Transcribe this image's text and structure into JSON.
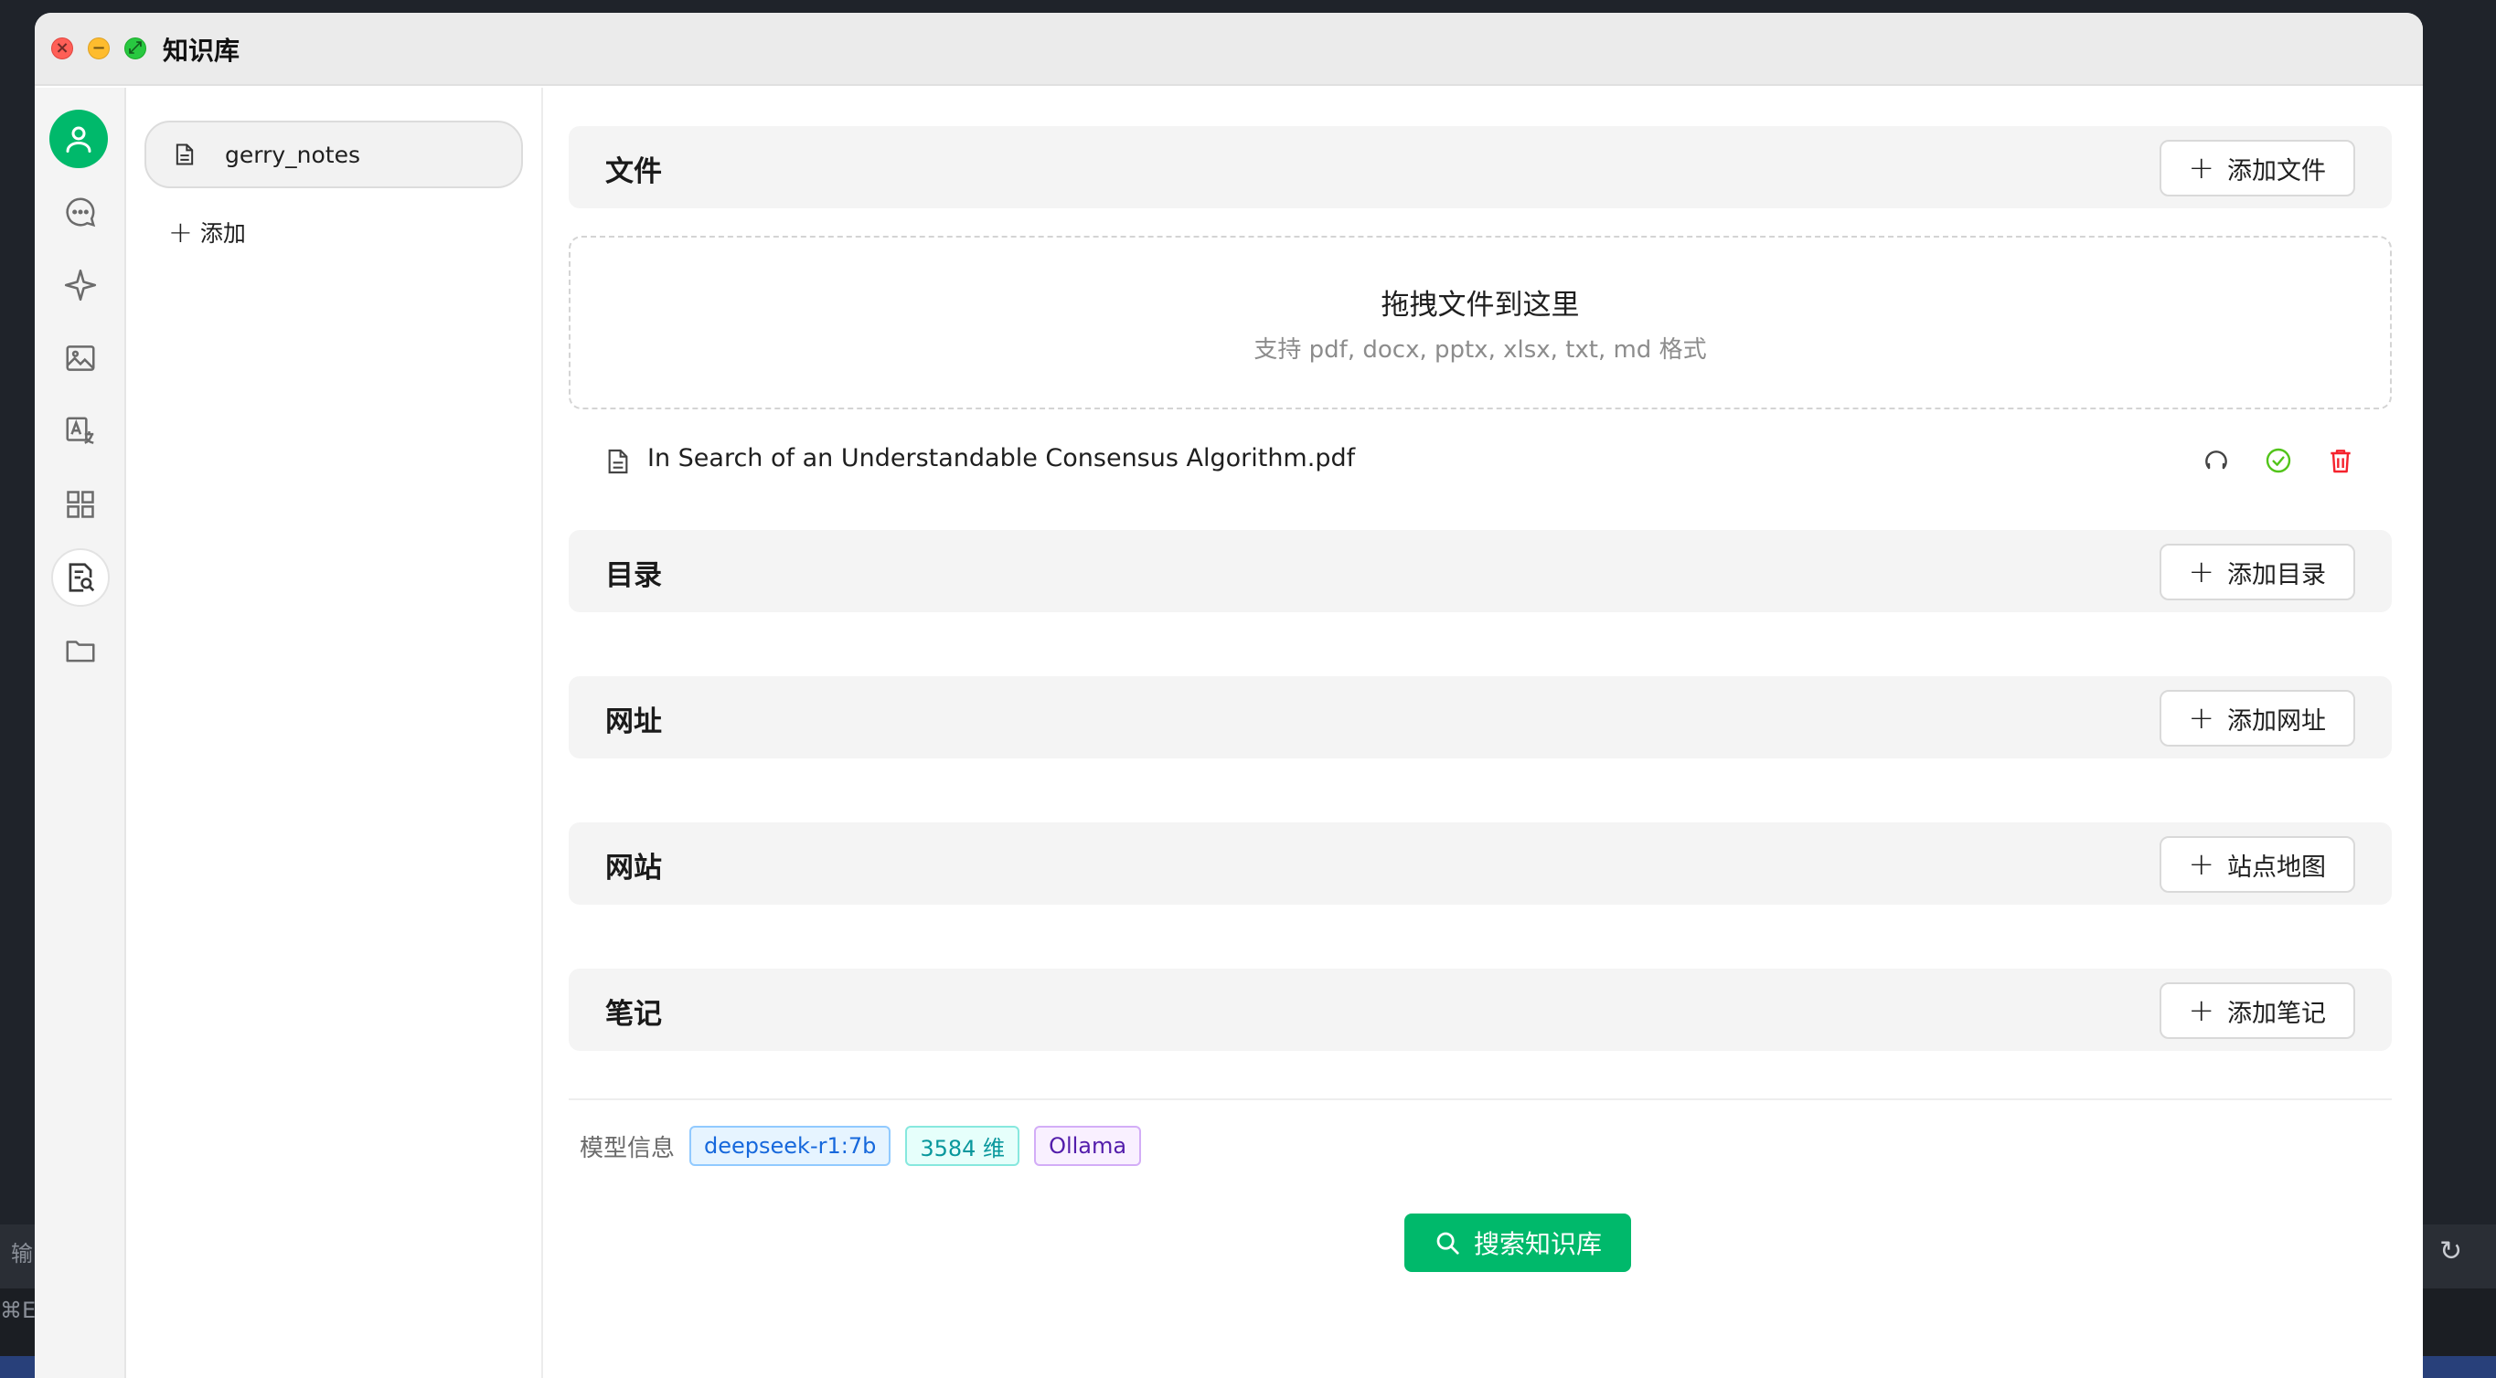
{
  "window": {
    "title": "知识库"
  },
  "background": {
    "left_text_1": "输",
    "left_text_2": "⌘E"
  },
  "knowledge_bases": {
    "items": [
      {
        "label": "gerry_notes"
      }
    ],
    "add_label": "添加"
  },
  "sections": {
    "files": {
      "title": "文件",
      "button": "添加文件"
    },
    "directories": {
      "title": "目录",
      "button": "添加目录"
    },
    "urls": {
      "title": "网址",
      "button": "添加网址"
    },
    "websites": {
      "title": "网站",
      "button": "站点地图"
    },
    "notes": {
      "title": "笔记",
      "button": "添加笔记"
    }
  },
  "dropzone": {
    "title": "拖拽文件到这里",
    "subtitle": "支持 pdf, docx, pptx, xlsx, txt, md 格式"
  },
  "files": [
    {
      "name": "In Search of an Understandable Consensus Algorithm.pdf"
    }
  ],
  "model_info": {
    "label": "模型信息",
    "model": "deepseek-r1:7b",
    "dimensions": "3584 维",
    "provider": "Ollama"
  },
  "search_button": "搜索知识库",
  "colors": {
    "accent": "#00b96b",
    "delete": "#f5222d",
    "success": "#52c41a"
  }
}
